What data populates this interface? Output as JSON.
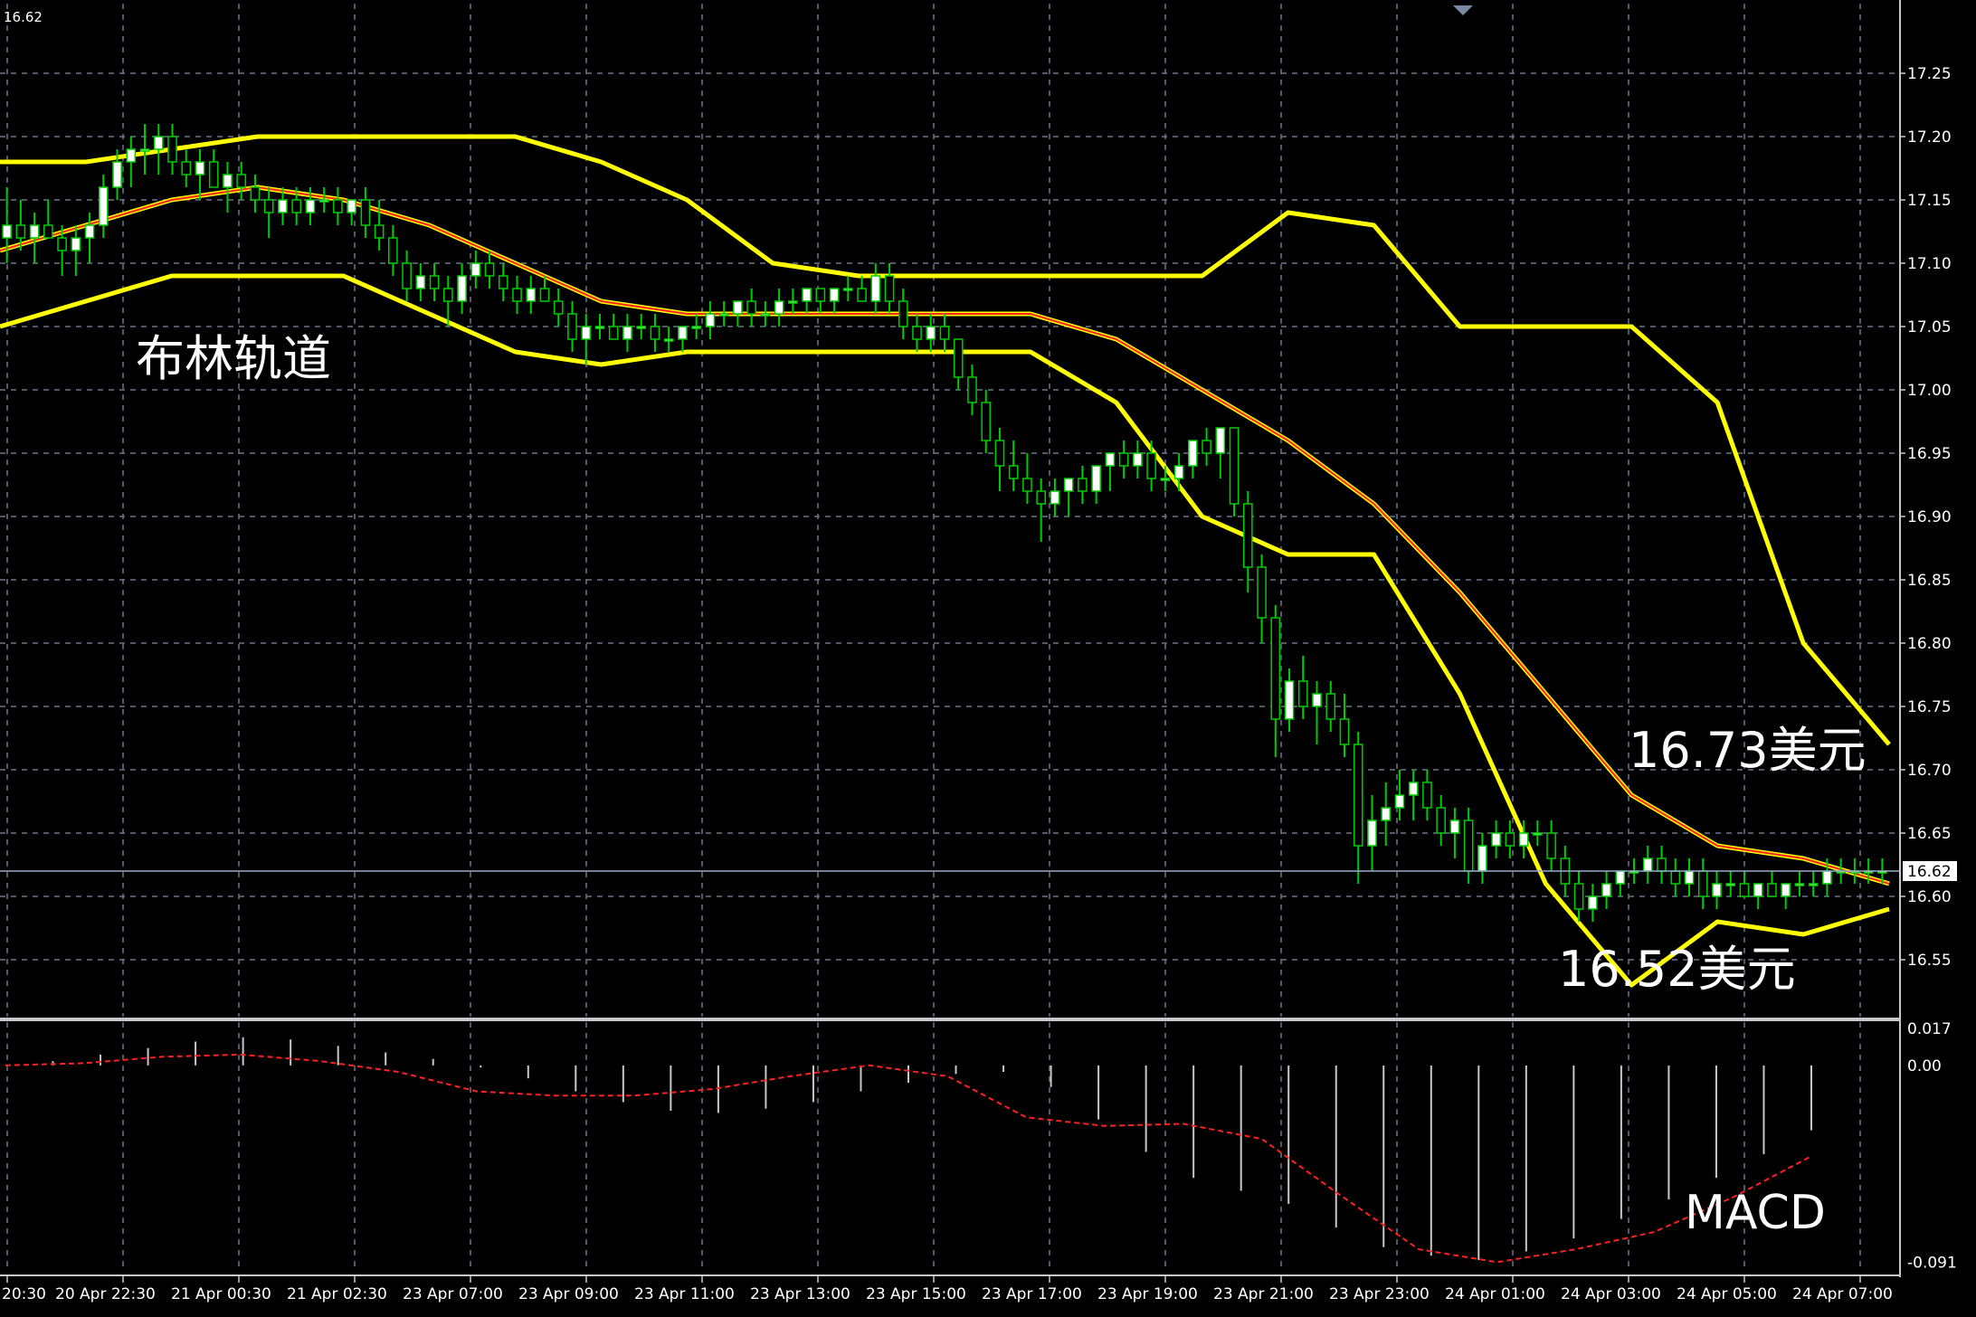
{
  "chart_data": {
    "type": "candlestick",
    "corner_price": "16.62",
    "current_price_label": "16.62",
    "annotations": {
      "bollinger_label": "布林轨道",
      "upper_label": "16.73美元",
      "lower_label": "16.52美元",
      "macd_label": "MACD"
    },
    "price_axis": {
      "range": [
        16.505,
        17.305
      ],
      "ticks": [
        "17.25",
        "17.20",
        "17.15",
        "17.10",
        "17.05",
        "17.00",
        "16.95",
        "16.90",
        "16.85",
        "16.80",
        "16.75",
        "16.70",
        "16.65",
        "16.60",
        "16.55"
      ]
    },
    "macd_axis": {
      "range": [
        -0.095,
        0.02
      ],
      "ticks": [
        "0.017",
        "0.00",
        "-0.091"
      ]
    },
    "time_axis": {
      "labels": [
        "20:30",
        "20 Apr 22:30",
        "21 Apr 00:30",
        "21 Apr 02:30",
        "23 Apr 07:00",
        "23 Apr 09:00",
        "23 Apr 11:00",
        "23 Apr 13:00",
        "23 Apr 15:00",
        "23 Apr 17:00",
        "23 Apr 19:00",
        "23 Apr 21:00",
        "23 Apr 23:00",
        "24 Apr 01:00",
        "24 Apr 03:00",
        "24 Apr 05:00",
        "24 Apr 07:00"
      ]
    },
    "bands_anchor_x": [
      0,
      8,
      16,
      24,
      32,
      40,
      48,
      56,
      64,
      72,
      80,
      88,
      96,
      104,
      112,
      120,
      128,
      136,
      144,
      152,
      160,
      168,
      176
    ],
    "upper_band": [
      17.18,
      17.18,
      17.19,
      17.2,
      17.2,
      17.2,
      17.2,
      17.18,
      17.15,
      17.1,
      17.09,
      17.09,
      17.09,
      17.09,
      17.09,
      17.14,
      17.13,
      17.05,
      17.05,
      17.05,
      16.99,
      16.8,
      16.72
    ],
    "middle_band": [
      17.11,
      17.13,
      17.15,
      17.16,
      17.15,
      17.13,
      17.1,
      17.07,
      17.06,
      17.06,
      17.06,
      17.06,
      17.06,
      17.04,
      17.0,
      16.96,
      16.91,
      16.84,
      16.76,
      16.68,
      16.64,
      16.63,
      16.61
    ],
    "lower_band": [
      17.05,
      17.07,
      17.09,
      17.09,
      17.09,
      17.06,
      17.03,
      17.02,
      17.03,
      17.03,
      17.03,
      17.03,
      17.03,
      16.99,
      16.9,
      16.87,
      16.87,
      16.76,
      16.61,
      16.53,
      16.58,
      16.57,
      16.59
    ],
    "signal_line": [
      0.0,
      0.001,
      0.004,
      0.005,
      0.002,
      -0.003,
      -0.012,
      -0.014,
      -0.014,
      -0.011,
      -0.005,
      -0.0,
      -0.005,
      -0.024,
      -0.028,
      -0.027,
      -0.034,
      -0.06,
      -0.085,
      -0.091,
      -0.085,
      -0.077,
      -0.061,
      -0.042
    ],
    "macd_hist": [
      0.0,
      0.002,
      0.005,
      0.008,
      0.011,
      0.013,
      0.012,
      0.009,
      0.006,
      0.003,
      -0.001,
      -0.006,
      -0.012,
      -0.017,
      -0.021,
      -0.022,
      -0.02,
      -0.017,
      -0.012,
      -0.008,
      -0.004,
      -0.003,
      -0.01,
      -0.025,
      -0.04,
      -0.052,
      -0.058,
      -0.064,
      -0.075,
      -0.084,
      -0.088,
      -0.09,
      -0.086,
      -0.08,
      -0.071,
      -0.062,
      -0.052,
      -0.041,
      -0.03
    ],
    "candles": [
      {
        "o": 17.12,
        "h": 17.16,
        "l": 17.1,
        "c": 17.13
      },
      {
        "o": 17.13,
        "h": 17.15,
        "l": 17.11,
        "c": 17.12
      },
      {
        "o": 17.12,
        "h": 17.14,
        "l": 17.1,
        "c": 17.13
      },
      {
        "o": 17.13,
        "h": 17.15,
        "l": 17.12,
        "c": 17.12
      },
      {
        "o": 17.12,
        "h": 17.13,
        "l": 17.09,
        "c": 17.11
      },
      {
        "o": 17.11,
        "h": 17.13,
        "l": 17.09,
        "c": 17.12
      },
      {
        "o": 17.12,
        "h": 17.14,
        "l": 17.1,
        "c": 17.13
      },
      {
        "o": 17.13,
        "h": 17.17,
        "l": 17.12,
        "c": 17.16
      },
      {
        "o": 17.16,
        "h": 17.19,
        "l": 17.15,
        "c": 17.18
      },
      {
        "o": 17.18,
        "h": 17.2,
        "l": 17.16,
        "c": 17.19
      },
      {
        "o": 17.19,
        "h": 17.21,
        "l": 17.17,
        "c": 17.19
      },
      {
        "o": 17.19,
        "h": 17.21,
        "l": 17.17,
        "c": 17.2
      },
      {
        "o": 17.2,
        "h": 17.21,
        "l": 17.17,
        "c": 17.18
      },
      {
        "o": 17.18,
        "h": 17.19,
        "l": 17.16,
        "c": 17.17
      },
      {
        "o": 17.17,
        "h": 17.19,
        "l": 17.15,
        "c": 17.18
      },
      {
        "o": 17.18,
        "h": 17.19,
        "l": 17.16,
        "c": 17.16
      },
      {
        "o": 17.16,
        "h": 17.18,
        "l": 17.14,
        "c": 17.17
      },
      {
        "o": 17.17,
        "h": 17.18,
        "l": 17.15,
        "c": 17.16
      },
      {
        "o": 17.16,
        "h": 17.17,
        "l": 17.14,
        "c": 17.15
      },
      {
        "o": 17.15,
        "h": 17.16,
        "l": 17.12,
        "c": 17.14
      },
      {
        "o": 17.14,
        "h": 17.16,
        "l": 17.13,
        "c": 17.15
      },
      {
        "o": 17.15,
        "h": 17.16,
        "l": 17.13,
        "c": 17.14
      },
      {
        "o": 17.14,
        "h": 17.16,
        "l": 17.13,
        "c": 17.15
      },
      {
        "o": 17.15,
        "h": 17.16,
        "l": 17.14,
        "c": 17.15
      },
      {
        "o": 17.15,
        "h": 17.16,
        "l": 17.13,
        "c": 17.14
      },
      {
        "o": 17.14,
        "h": 17.15,
        "l": 17.13,
        "c": 17.15
      },
      {
        "o": 17.15,
        "h": 17.16,
        "l": 17.12,
        "c": 17.13
      },
      {
        "o": 17.13,
        "h": 17.15,
        "l": 17.11,
        "c": 17.12
      },
      {
        "o": 17.12,
        "h": 17.13,
        "l": 17.09,
        "c": 17.1
      },
      {
        "o": 17.1,
        "h": 17.11,
        "l": 17.07,
        "c": 17.08
      },
      {
        "o": 17.08,
        "h": 17.1,
        "l": 17.07,
        "c": 17.09
      },
      {
        "o": 17.09,
        "h": 17.1,
        "l": 17.07,
        "c": 17.08
      },
      {
        "o": 17.08,
        "h": 17.09,
        "l": 17.05,
        "c": 17.07
      },
      {
        "o": 17.07,
        "h": 17.1,
        "l": 17.06,
        "c": 17.09
      },
      {
        "o": 17.09,
        "h": 17.11,
        "l": 17.08,
        "c": 17.1
      },
      {
        "o": 17.1,
        "h": 17.11,
        "l": 17.08,
        "c": 17.09
      },
      {
        "o": 17.09,
        "h": 17.1,
        "l": 17.07,
        "c": 17.08
      },
      {
        "o": 17.08,
        "h": 17.09,
        "l": 17.06,
        "c": 17.07
      },
      {
        "o": 17.07,
        "h": 17.09,
        "l": 17.06,
        "c": 17.08
      },
      {
        "o": 17.08,
        "h": 17.09,
        "l": 17.07,
        "c": 17.07
      },
      {
        "o": 17.07,
        "h": 17.08,
        "l": 17.05,
        "c": 17.06
      },
      {
        "o": 17.06,
        "h": 17.07,
        "l": 17.03,
        "c": 17.04
      },
      {
        "o": 17.04,
        "h": 17.06,
        "l": 17.02,
        "c": 17.05
      },
      {
        "o": 17.05,
        "h": 17.06,
        "l": 17.04,
        "c": 17.05
      },
      {
        "o": 17.05,
        "h": 17.06,
        "l": 17.04,
        "c": 17.04
      },
      {
        "o": 17.04,
        "h": 17.06,
        "l": 17.03,
        "c": 17.05
      },
      {
        "o": 17.05,
        "h": 17.06,
        "l": 17.04,
        "c": 17.05
      },
      {
        "o": 17.05,
        "h": 17.06,
        "l": 17.03,
        "c": 17.04
      },
      {
        "o": 17.04,
        "h": 17.05,
        "l": 17.03,
        "c": 17.04
      },
      {
        "o": 17.04,
        "h": 17.05,
        "l": 17.03,
        "c": 17.05
      },
      {
        "o": 17.05,
        "h": 17.06,
        "l": 17.04,
        "c": 17.05
      },
      {
        "o": 17.05,
        "h": 17.07,
        "l": 17.04,
        "c": 17.06
      },
      {
        "o": 17.06,
        "h": 17.07,
        "l": 17.05,
        "c": 17.06
      },
      {
        "o": 17.06,
        "h": 17.07,
        "l": 17.05,
        "c": 17.07
      },
      {
        "o": 17.07,
        "h": 17.08,
        "l": 17.05,
        "c": 17.06
      },
      {
        "o": 17.06,
        "h": 17.07,
        "l": 17.05,
        "c": 17.06
      },
      {
        "o": 17.06,
        "h": 17.08,
        "l": 17.05,
        "c": 17.07
      },
      {
        "o": 17.07,
        "h": 17.08,
        "l": 17.06,
        "c": 17.07
      },
      {
        "o": 17.07,
        "h": 17.08,
        "l": 17.06,
        "c": 17.08
      },
      {
        "o": 17.08,
        "h": 17.08,
        "l": 17.06,
        "c": 17.07
      },
      {
        "o": 17.07,
        "h": 17.08,
        "l": 17.06,
        "c": 17.08
      },
      {
        "o": 17.08,
        "h": 17.09,
        "l": 17.07,
        "c": 17.08
      },
      {
        "o": 17.08,
        "h": 17.09,
        "l": 17.07,
        "c": 17.07
      },
      {
        "o": 17.07,
        "h": 17.1,
        "l": 17.06,
        "c": 17.09
      },
      {
        "o": 17.09,
        "h": 17.1,
        "l": 17.06,
        "c": 17.07
      },
      {
        "o": 17.07,
        "h": 17.08,
        "l": 17.04,
        "c": 17.05
      },
      {
        "o": 17.05,
        "h": 17.06,
        "l": 17.03,
        "c": 17.04
      },
      {
        "o": 17.04,
        "h": 17.06,
        "l": 17.03,
        "c": 17.05
      },
      {
        "o": 17.05,
        "h": 17.06,
        "l": 17.03,
        "c": 17.04
      },
      {
        "o": 17.04,
        "h": 17.04,
        "l": 17.0,
        "c": 17.01
      },
      {
        "o": 17.01,
        "h": 17.02,
        "l": 16.98,
        "c": 16.99
      },
      {
        "o": 16.99,
        "h": 17.0,
        "l": 16.95,
        "c": 16.96
      },
      {
        "o": 16.96,
        "h": 16.97,
        "l": 16.92,
        "c": 16.94
      },
      {
        "o": 16.94,
        "h": 16.96,
        "l": 16.92,
        "c": 16.93
      },
      {
        "o": 16.93,
        "h": 16.95,
        "l": 16.91,
        "c": 16.92
      },
      {
        "o": 16.92,
        "h": 16.93,
        "l": 16.88,
        "c": 16.91
      },
      {
        "o": 16.91,
        "h": 16.93,
        "l": 16.9,
        "c": 16.92
      },
      {
        "o": 16.92,
        "h": 16.93,
        "l": 16.9,
        "c": 16.93
      },
      {
        "o": 16.93,
        "h": 16.94,
        "l": 16.91,
        "c": 16.92
      },
      {
        "o": 16.92,
        "h": 16.94,
        "l": 16.91,
        "c": 16.94
      },
      {
        "o": 16.94,
        "h": 16.95,
        "l": 16.92,
        "c": 16.95
      },
      {
        "o": 16.95,
        "h": 16.96,
        "l": 16.93,
        "c": 16.94
      },
      {
        "o": 16.94,
        "h": 16.96,
        "l": 16.93,
        "c": 16.95
      },
      {
        "o": 16.95,
        "h": 16.96,
        "l": 16.92,
        "c": 16.93
      },
      {
        "o": 16.93,
        "h": 16.94,
        "l": 16.92,
        "c": 16.93
      },
      {
        "o": 16.93,
        "h": 16.95,
        "l": 16.92,
        "c": 16.94
      },
      {
        "o": 16.94,
        "h": 16.96,
        "l": 16.93,
        "c": 16.96
      },
      {
        "o": 16.96,
        "h": 16.97,
        "l": 16.94,
        "c": 16.95
      },
      {
        "o": 16.95,
        "h": 16.97,
        "l": 16.93,
        "c": 16.97
      },
      {
        "o": 16.97,
        "h": 16.97,
        "l": 16.9,
        "c": 16.91
      },
      {
        "o": 16.91,
        "h": 16.92,
        "l": 16.84,
        "c": 16.86
      },
      {
        "o": 16.86,
        "h": 16.87,
        "l": 16.8,
        "c": 16.82
      },
      {
        "o": 16.82,
        "h": 16.83,
        "l": 16.71,
        "c": 16.74
      },
      {
        "o": 16.74,
        "h": 16.78,
        "l": 16.73,
        "c": 16.77
      },
      {
        "o": 16.77,
        "h": 16.79,
        "l": 16.74,
        "c": 16.75
      },
      {
        "o": 16.75,
        "h": 16.77,
        "l": 16.72,
        "c": 16.76
      },
      {
        "o": 16.76,
        "h": 16.77,
        "l": 16.73,
        "c": 16.74
      },
      {
        "o": 16.74,
        "h": 16.76,
        "l": 16.71,
        "c": 16.72
      },
      {
        "o": 16.72,
        "h": 16.73,
        "l": 16.61,
        "c": 16.64
      },
      {
        "o": 16.64,
        "h": 16.68,
        "l": 16.62,
        "c": 16.66
      },
      {
        "o": 16.66,
        "h": 16.69,
        "l": 16.64,
        "c": 16.67
      },
      {
        "o": 16.67,
        "h": 16.7,
        "l": 16.66,
        "c": 16.68
      },
      {
        "o": 16.68,
        "h": 16.7,
        "l": 16.66,
        "c": 16.69
      },
      {
        "o": 16.69,
        "h": 16.7,
        "l": 16.66,
        "c": 16.67
      },
      {
        "o": 16.67,
        "h": 16.68,
        "l": 16.64,
        "c": 16.65
      },
      {
        "o": 16.65,
        "h": 16.67,
        "l": 16.63,
        "c": 16.66
      },
      {
        "o": 16.66,
        "h": 16.67,
        "l": 16.61,
        "c": 16.62
      },
      {
        "o": 16.62,
        "h": 16.65,
        "l": 16.61,
        "c": 16.64
      },
      {
        "o": 16.64,
        "h": 16.66,
        "l": 16.63,
        "c": 16.65
      },
      {
        "o": 16.65,
        "h": 16.66,
        "l": 16.63,
        "c": 16.64
      },
      {
        "o": 16.64,
        "h": 16.66,
        "l": 16.63,
        "c": 16.65
      },
      {
        "o": 16.65,
        "h": 16.66,
        "l": 16.64,
        "c": 16.65
      },
      {
        "o": 16.65,
        "h": 16.66,
        "l": 16.62,
        "c": 16.63
      },
      {
        "o": 16.63,
        "h": 16.64,
        "l": 16.6,
        "c": 16.61
      },
      {
        "o": 16.61,
        "h": 16.62,
        "l": 16.58,
        "c": 16.59
      },
      {
        "o": 16.59,
        "h": 16.61,
        "l": 16.58,
        "c": 16.6
      },
      {
        "o": 16.6,
        "h": 16.62,
        "l": 16.59,
        "c": 16.61
      },
      {
        "o": 16.61,
        "h": 16.62,
        "l": 16.6,
        "c": 16.62
      },
      {
        "o": 16.62,
        "h": 16.63,
        "l": 16.61,
        "c": 16.62
      },
      {
        "o": 16.62,
        "h": 16.64,
        "l": 16.61,
        "c": 16.63
      },
      {
        "o": 16.63,
        "h": 16.64,
        "l": 16.61,
        "c": 16.62
      },
      {
        "o": 16.62,
        "h": 16.63,
        "l": 16.6,
        "c": 16.61
      },
      {
        "o": 16.61,
        "h": 16.63,
        "l": 16.6,
        "c": 16.62
      },
      {
        "o": 16.62,
        "h": 16.63,
        "l": 16.59,
        "c": 16.6
      },
      {
        "o": 16.6,
        "h": 16.62,
        "l": 16.59,
        "c": 16.61
      },
      {
        "o": 16.61,
        "h": 16.62,
        "l": 16.6,
        "c": 16.61
      },
      {
        "o": 16.61,
        "h": 16.62,
        "l": 16.6,
        "c": 16.6
      },
      {
        "o": 16.6,
        "h": 16.61,
        "l": 16.59,
        "c": 16.61
      },
      {
        "o": 16.61,
        "h": 16.62,
        "l": 16.6,
        "c": 16.6
      },
      {
        "o": 16.6,
        "h": 16.61,
        "l": 16.59,
        "c": 16.61
      },
      {
        "o": 16.61,
        "h": 16.62,
        "l": 16.6,
        "c": 16.61
      },
      {
        "o": 16.61,
        "h": 16.62,
        "l": 16.6,
        "c": 16.61
      },
      {
        "o": 16.61,
        "h": 16.63,
        "l": 16.6,
        "c": 16.62
      },
      {
        "o": 16.62,
        "h": 16.63,
        "l": 16.61,
        "c": 16.62
      },
      {
        "o": 16.62,
        "h": 16.63,
        "l": 16.61,
        "c": 16.62
      },
      {
        "o": 16.62,
        "h": 16.63,
        "l": 16.61,
        "c": 16.62
      },
      {
        "o": 16.62,
        "h": 16.63,
        "l": 16.61,
        "c": 16.62
      }
    ],
    "colors": {
      "background": "#000000",
      "grid": "#6e7787",
      "bands": "#ffff00",
      "middle_line": "#ff2020",
      "bull_body": "#ffffff",
      "bear_body": "#000000",
      "wick": "#00cc00",
      "hist": "#c8c8c8",
      "signal": "#ff2020",
      "axis_text": "#ffffff",
      "price_line": "#9aaacc"
    }
  }
}
